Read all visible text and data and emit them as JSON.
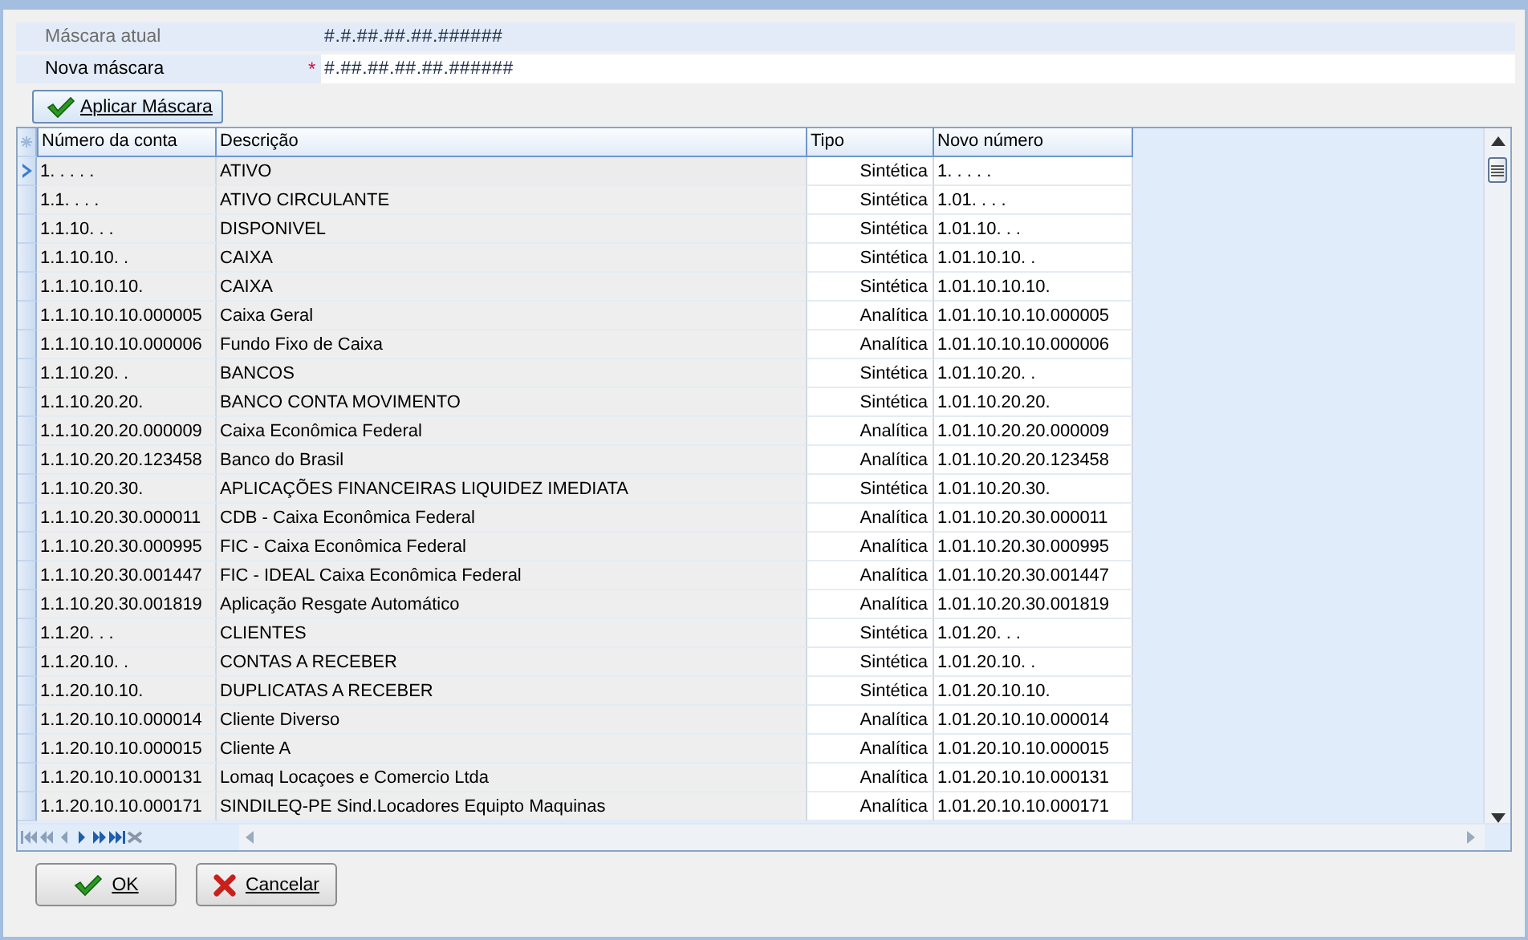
{
  "mask_form": {
    "current_mask": {
      "label": "Máscara atual",
      "value": "#.#.##.##.##.######"
    },
    "new_mask": {
      "label": "Nova máscara",
      "required_mark": "*",
      "value": "#.##.##.##.##.######"
    },
    "apply_button": "Aplicar Máscara"
  },
  "table": {
    "columns": [
      "Número da conta",
      "Descrição",
      "Tipo",
      "Novo número"
    ],
    "rows": [
      {
        "selected": true,
        "cells": [
          "1. . . . .",
          "ATIVO",
          "Sintética",
          "1. . . . ."
        ]
      },
      {
        "selected": false,
        "cells": [
          "1.1. . . .",
          "ATIVO CIRCULANTE",
          "Sintética",
          "1.01. . . ."
        ]
      },
      {
        "selected": false,
        "cells": [
          "1.1.10. . .",
          "DISPONIVEL",
          "Sintética",
          "1.01.10. . ."
        ]
      },
      {
        "selected": false,
        "cells": [
          "1.1.10.10. .",
          "CAIXA",
          "Sintética",
          "1.01.10.10. ."
        ]
      },
      {
        "selected": false,
        "cells": [
          "1.1.10.10.10.",
          "CAIXA",
          "Sintética",
          "1.01.10.10.10."
        ]
      },
      {
        "selected": false,
        "cells": [
          "1.1.10.10.10.000005",
          "Caixa Geral",
          "Analítica",
          "1.01.10.10.10.000005"
        ]
      },
      {
        "selected": false,
        "cells": [
          "1.1.10.10.10.000006",
          "Fundo Fixo de Caixa",
          "Analítica",
          "1.01.10.10.10.000006"
        ]
      },
      {
        "selected": false,
        "cells": [
          "1.1.10.20. .",
          "BANCOS",
          "Sintética",
          "1.01.10.20. ."
        ]
      },
      {
        "selected": false,
        "cells": [
          "1.1.10.20.20.",
          "BANCO CONTA MOVIMENTO",
          "Sintética",
          "1.01.10.20.20."
        ]
      },
      {
        "selected": false,
        "cells": [
          "1.1.10.20.20.000009",
          "Caixa Econômica Federal",
          "Analítica",
          "1.01.10.20.20.000009"
        ]
      },
      {
        "selected": false,
        "cells": [
          "1.1.10.20.20.123458",
          "Banco do Brasil",
          "Analítica",
          "1.01.10.20.20.123458"
        ]
      },
      {
        "selected": false,
        "cells": [
          "1.1.10.20.30.",
          "APLICAÇÕES FINANCEIRAS LIQUIDEZ IMEDIATA",
          "Sintética",
          "1.01.10.20.30."
        ]
      },
      {
        "selected": false,
        "cells": [
          "1.1.10.20.30.000011",
          "CDB - Caixa Econômica Federal",
          "Analítica",
          "1.01.10.20.30.000011"
        ]
      },
      {
        "selected": false,
        "cells": [
          "1.1.10.20.30.000995",
          "FIC - Caixa Econômica Federal",
          "Analítica",
          "1.01.10.20.30.000995"
        ]
      },
      {
        "selected": false,
        "cells": [
          "1.1.10.20.30.001447",
          "FIC - IDEAL Caixa Econômica Federal",
          "Analítica",
          "1.01.10.20.30.001447"
        ]
      },
      {
        "selected": false,
        "cells": [
          "1.1.10.20.30.001819",
          "Aplicação Resgate Automático",
          "Analítica",
          "1.01.10.20.30.001819"
        ]
      },
      {
        "selected": false,
        "cells": [
          "1.1.20. . .",
          "CLIENTES",
          "Sintética",
          "1.01.20. . ."
        ]
      },
      {
        "selected": false,
        "cells": [
          "1.1.20.10. .",
          "CONTAS A RECEBER",
          "Sintética",
          "1.01.20.10. ."
        ]
      },
      {
        "selected": false,
        "cells": [
          "1.1.20.10.10.",
          "DUPLICATAS A RECEBER",
          "Sintética",
          "1.01.20.10.10."
        ]
      },
      {
        "selected": false,
        "cells": [
          "1.1.20.10.10.000014",
          "Cliente Diverso",
          "Analítica",
          "1.01.20.10.10.000014"
        ]
      },
      {
        "selected": false,
        "cells": [
          "1.1.20.10.10.000015",
          "Cliente A",
          "Analítica",
          "1.01.20.10.10.000015"
        ]
      },
      {
        "selected": false,
        "cells": [
          "1.1.20.10.10.000131",
          "Lomaq Locaçoes e Comercio Ltda",
          "Analítica",
          "1.01.20.10.10.000131"
        ]
      },
      {
        "selected": false,
        "cells": [
          "1.1.20.10.10.000171",
          "SINDILEQ-PE Sind.Locadores Equipto Maquinas",
          "Analítica",
          "1.01.20.10.10.000171"
        ]
      }
    ]
  },
  "buttons": [
    {
      "kind": "ok",
      "label": "OK"
    },
    {
      "kind": "cancel",
      "label": "Cancelar"
    }
  ]
}
